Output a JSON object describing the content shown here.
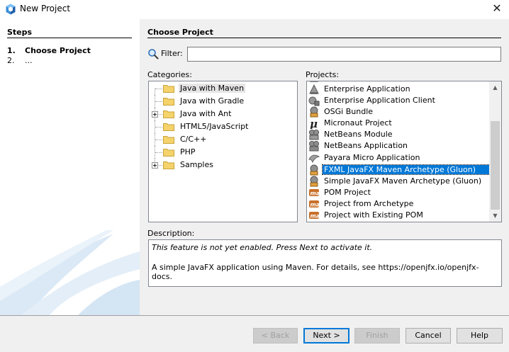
{
  "window": {
    "title": "New Project",
    "close_glyph": "✕"
  },
  "steps": {
    "title": "Steps",
    "items": [
      {
        "num": "1.",
        "label": "Choose Project"
      },
      {
        "num": "2.",
        "label": "..."
      }
    ]
  },
  "panel": {
    "title": "Choose Project",
    "filter_label": "Filter:",
    "filter_value": "",
    "categories_label": "Categories:",
    "projects_label": "Projects:",
    "description_label": "Description:"
  },
  "categories": [
    {
      "label": "Java with Maven",
      "selected": true,
      "expandable": false
    },
    {
      "label": "Java with Gradle",
      "selected": false,
      "expandable": false
    },
    {
      "label": "Java with Ant",
      "selected": false,
      "expandable": true
    },
    {
      "label": "HTML5/JavaScript",
      "selected": false,
      "expandable": false
    },
    {
      "label": "C/C++",
      "selected": false,
      "expandable": false
    },
    {
      "label": "PHP",
      "selected": false,
      "expandable": false
    },
    {
      "label": "Samples",
      "selected": false,
      "expandable": true
    }
  ],
  "projects": [
    {
      "label": "Enterprise Application",
      "icon": "enterprise-app-icon",
      "selected": false
    },
    {
      "label": "Enterprise Application Client",
      "icon": "enterprise-client-icon",
      "selected": false
    },
    {
      "label": "OSGi Bundle",
      "icon": "osgi-bundle-icon",
      "selected": false
    },
    {
      "label": "Micronaut Project",
      "icon": "micronaut-icon",
      "selected": false
    },
    {
      "label": "NetBeans Module",
      "icon": "netbeans-module-icon",
      "selected": false
    },
    {
      "label": "NetBeans Application",
      "icon": "netbeans-app-icon",
      "selected": false
    },
    {
      "label": "Payara Micro Application",
      "icon": "payara-icon",
      "selected": false
    },
    {
      "label": "FXML JavaFX Maven Archetype (Gluon)",
      "icon": "gluon-fxml-icon",
      "selected": true
    },
    {
      "label": "Simple JavaFX Maven Archetype (Gluon)",
      "icon": "gluon-simple-icon",
      "selected": false
    },
    {
      "label": "POM Project",
      "icon": "maven-icon",
      "selected": false
    },
    {
      "label": "Project from Archetype",
      "icon": "maven-icon",
      "selected": false
    },
    {
      "label": "Project with Existing POM",
      "icon": "maven-icon",
      "selected": false
    }
  ],
  "description": {
    "line1": "This feature is not yet enabled. Press Next to activate it.",
    "line2": "A simple JavaFX application using Maven. For details, see https://openjfx.io/openjfx-docs."
  },
  "buttons": {
    "back": "< Back",
    "next": "Next >",
    "finish": "Finish",
    "cancel": "Cancel",
    "help": "Help"
  },
  "colors": {
    "selection": "#0078d7",
    "folder": "#f4d36b",
    "maven_orange": "#c8702a"
  }
}
